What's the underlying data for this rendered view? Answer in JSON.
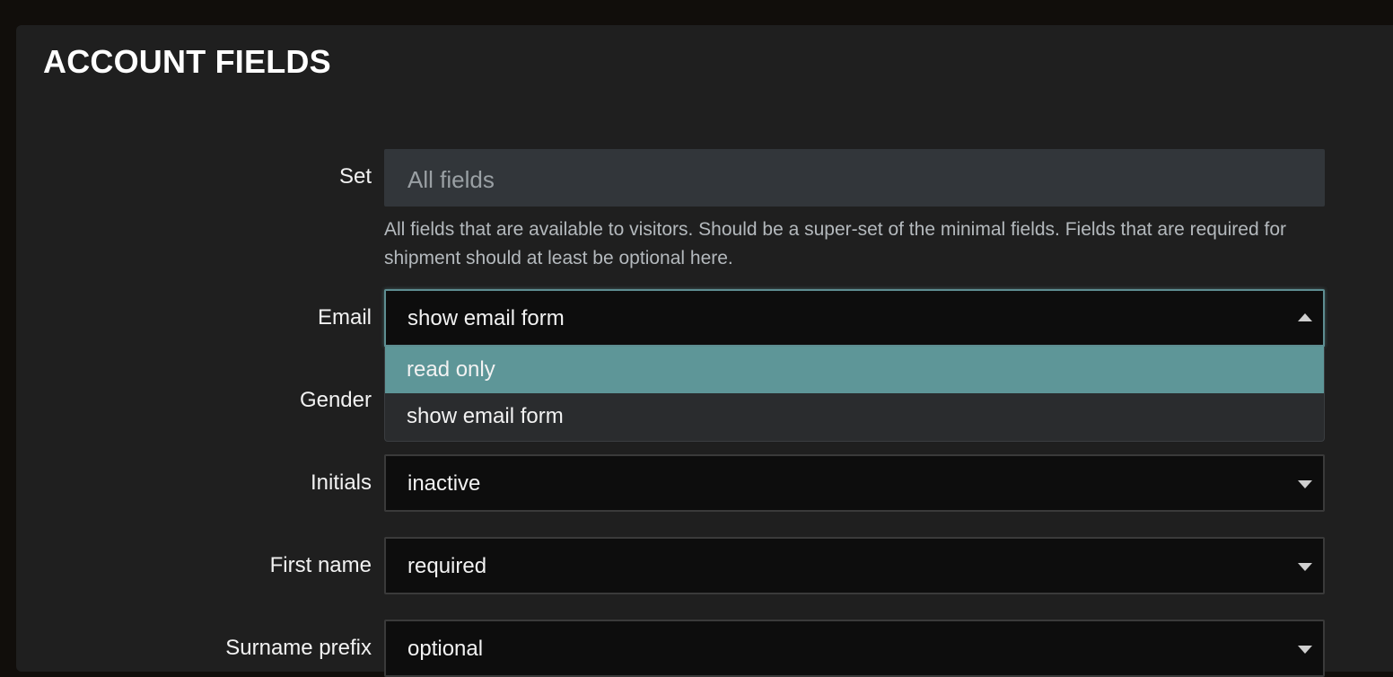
{
  "panel": {
    "title": "ACCOUNT FIELDS"
  },
  "set": {
    "label": "Set",
    "placeholder": "All fields",
    "help": "All fields that are available to visitors. Should be a super-set of the minimal fields. Fields that are required for shipment should at least be optional here."
  },
  "fields": [
    {
      "label": "Email",
      "value": "show email form",
      "open": true
    },
    {
      "label": "Gender",
      "value": ""
    },
    {
      "label": "Initials",
      "value": "inactive"
    },
    {
      "label": "First name",
      "value": "required"
    },
    {
      "label": "Surname prefix",
      "value": "optional"
    }
  ],
  "email_dropdown": {
    "options": [
      {
        "label": "read only",
        "highlighted": true
      },
      {
        "label": "show email form",
        "highlighted": false
      }
    ]
  },
  "colors": {
    "highlight": "#5e9698",
    "panel_bg": "#1f1f1f",
    "select_bg": "#0d0d0d"
  }
}
